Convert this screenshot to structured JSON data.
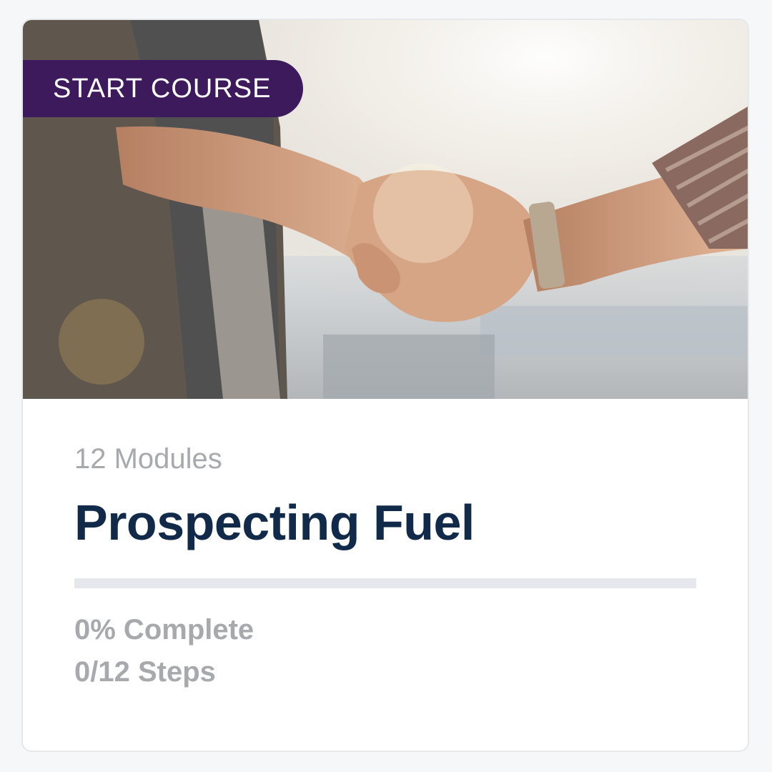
{
  "card": {
    "badge_label": "START COURSE",
    "modules_label": "12 Modules",
    "title": "Prospecting Fuel",
    "progress_fraction": 0,
    "complete_label": "0% Complete",
    "steps_label": "0/12 Steps",
    "image_icon": "handshake-photo"
  },
  "colors": {
    "badge_bg": "#3c1a5c",
    "title": "#112a4a",
    "muted_text": "#a8a9ad",
    "progress_track": "#e7e8ed"
  }
}
